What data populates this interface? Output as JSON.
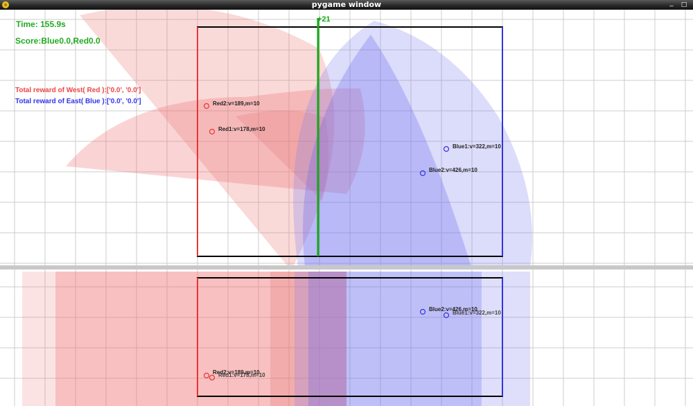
{
  "window": {
    "title": "pygame window",
    "minimize_glyph": "_",
    "maximize_glyph": "□"
  },
  "hud": {
    "time": "Time: 155.9s",
    "score": "Score:Blue0.0,Red0.0",
    "west_reward": "Total reward of West( Red ):['0.0', '0.0']",
    "east_reward": "Total reward of East( Blue ):['0.0', '0.0']",
    "line_marker": "+21"
  },
  "units": {
    "red2": "Red2:v=189,m=10",
    "red1": "Red1:v=178,m=10",
    "blue1": "Blue1:v=322,m=10",
    "blue2": "Blue2:v=426,m=10",
    "red2_side": "Red2:v=189,m=10",
    "red1_side": "Red1:v=178,m=10",
    "blue2_side": "Blue2:v=426,m=10",
    "blue1_side": "Blue1:v=322,m=10"
  },
  "colors": {
    "red_team": "#ee3333",
    "blue_team": "#3333dd",
    "front_line": "#11aa11",
    "grid": "#cccccc",
    "separator": "#c8c8c8"
  },
  "icons": {
    "app_icon": "pygame-snake-icon"
  }
}
